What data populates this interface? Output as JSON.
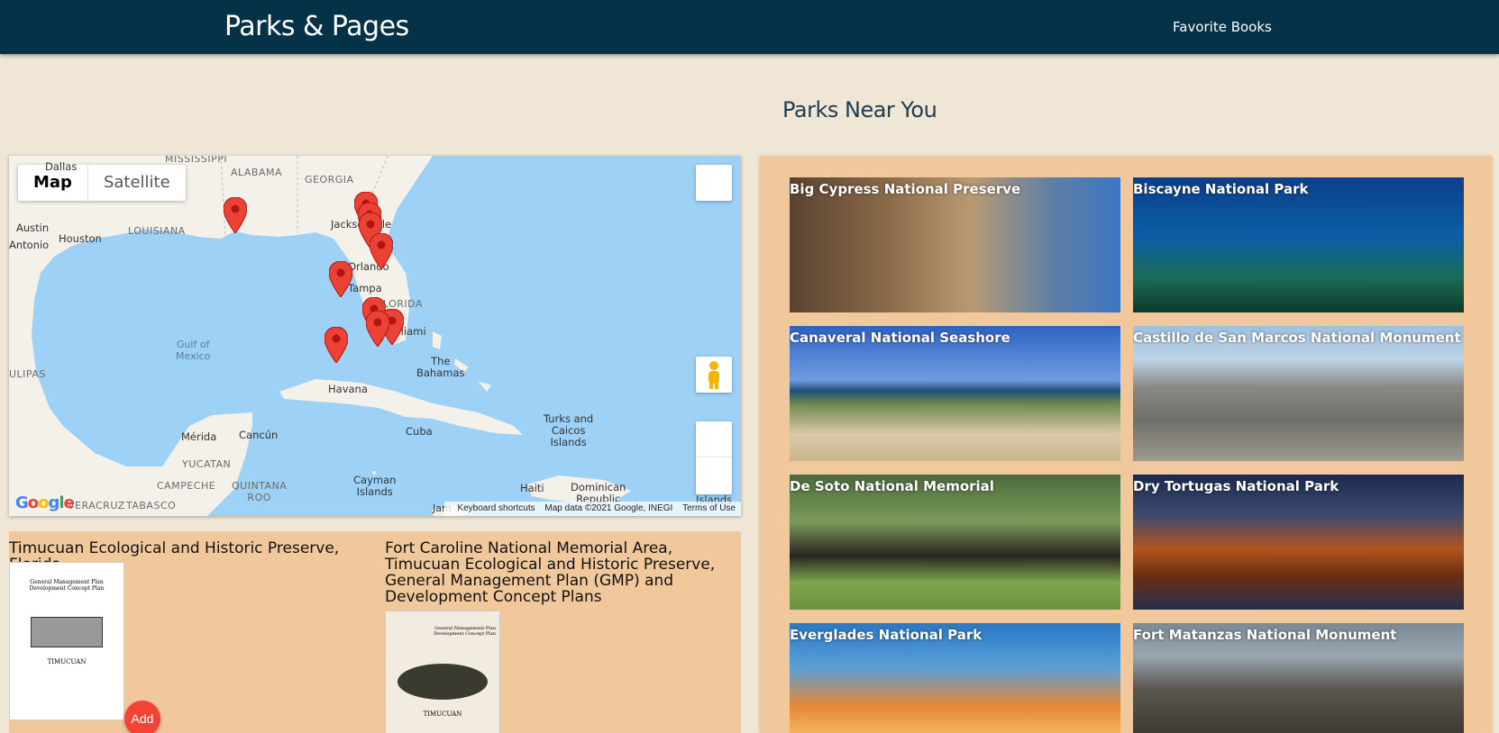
{
  "header": {
    "brand": "Parks & Pages",
    "nav_favorite": "Favorite Books"
  },
  "main": {
    "section_title": "Parks Near You"
  },
  "map": {
    "type_map": "Map",
    "type_satellite": "Satellite",
    "labels": {
      "mississippi": "MISSISSIPPI",
      "alabama": "ALABAMA",
      "georgia": "GEORGIA",
      "louisiana": "LOUISIANA",
      "dallas": "Dallas",
      "austin": "Austin",
      "houston": "Houston",
      "antonio": "Antonio",
      "jacksonville": "Jacksonville",
      "orlando": "Orlando",
      "tampa": "Tampa",
      "florida": "FLORIDA",
      "miami": "Miami",
      "gulf": "Gulf of\nMexico",
      "bahamas": "The\nBahamas",
      "havana": "Havana",
      "cuba": "Cuba",
      "turks": "Turks and\nCaicos\nIslands",
      "merida": "Mérida",
      "cancun": "Cancún",
      "yucatan": "YUCATAN",
      "campeche": "CAMPECHE",
      "quintana": "QUINTANA\nROO",
      "tabasco": "TABASCO",
      "veracruz": "VERACRUZ",
      "cayman": "Cayman\nIslands",
      "haiti": "Haiti",
      "dominican": "Dominican\nRepublic",
      "islands": "Islands",
      "jam": "Jam",
      "ulipas": "ULIPAS"
    },
    "attribution": {
      "shortcuts": "Keyboard shortcuts",
      "data": "Map data ©2021 Google, INEGI",
      "terms": "Terms of Use"
    },
    "google": "Google",
    "colors": {
      "land": "#f4f1ea",
      "water": "#9dd1f5",
      "pin": "#ea4335"
    }
  },
  "books": [
    {
      "title": "Timucuan Ecological and Historic Preserve, Florida",
      "cover_text": "General Management Plan\nDevelopment Concept Plan",
      "cover_sub": "TIMUCUAN"
    },
    {
      "title": "Fort Caroline National Memorial Area, Timucuan Ecological and Historic Preserve, General Management Plan (GMP) and Development Concept Plans",
      "cover_text": "General Management Plan\nDevelopment Concept Plan",
      "cover_sub": "TIMUCUAN"
    }
  ],
  "add_label": "Add",
  "parks": [
    {
      "name": "Big Cypress National Preserve",
      "scene": "panther"
    },
    {
      "name": "Biscayne National Park",
      "scene": "reef"
    },
    {
      "name": "Canaveral National Seashore",
      "scene": "beach"
    },
    {
      "name": "Castillo de San Marcos National Monument",
      "scene": "fort"
    },
    {
      "name": "De Soto National Memorial",
      "scene": "horse"
    },
    {
      "name": "Dry Tortugas National Park",
      "scene": "night-fort"
    },
    {
      "name": "Everglades National Park",
      "scene": "sunset"
    },
    {
      "name": "Fort Matanzas National Monument",
      "scene": "tower"
    }
  ]
}
